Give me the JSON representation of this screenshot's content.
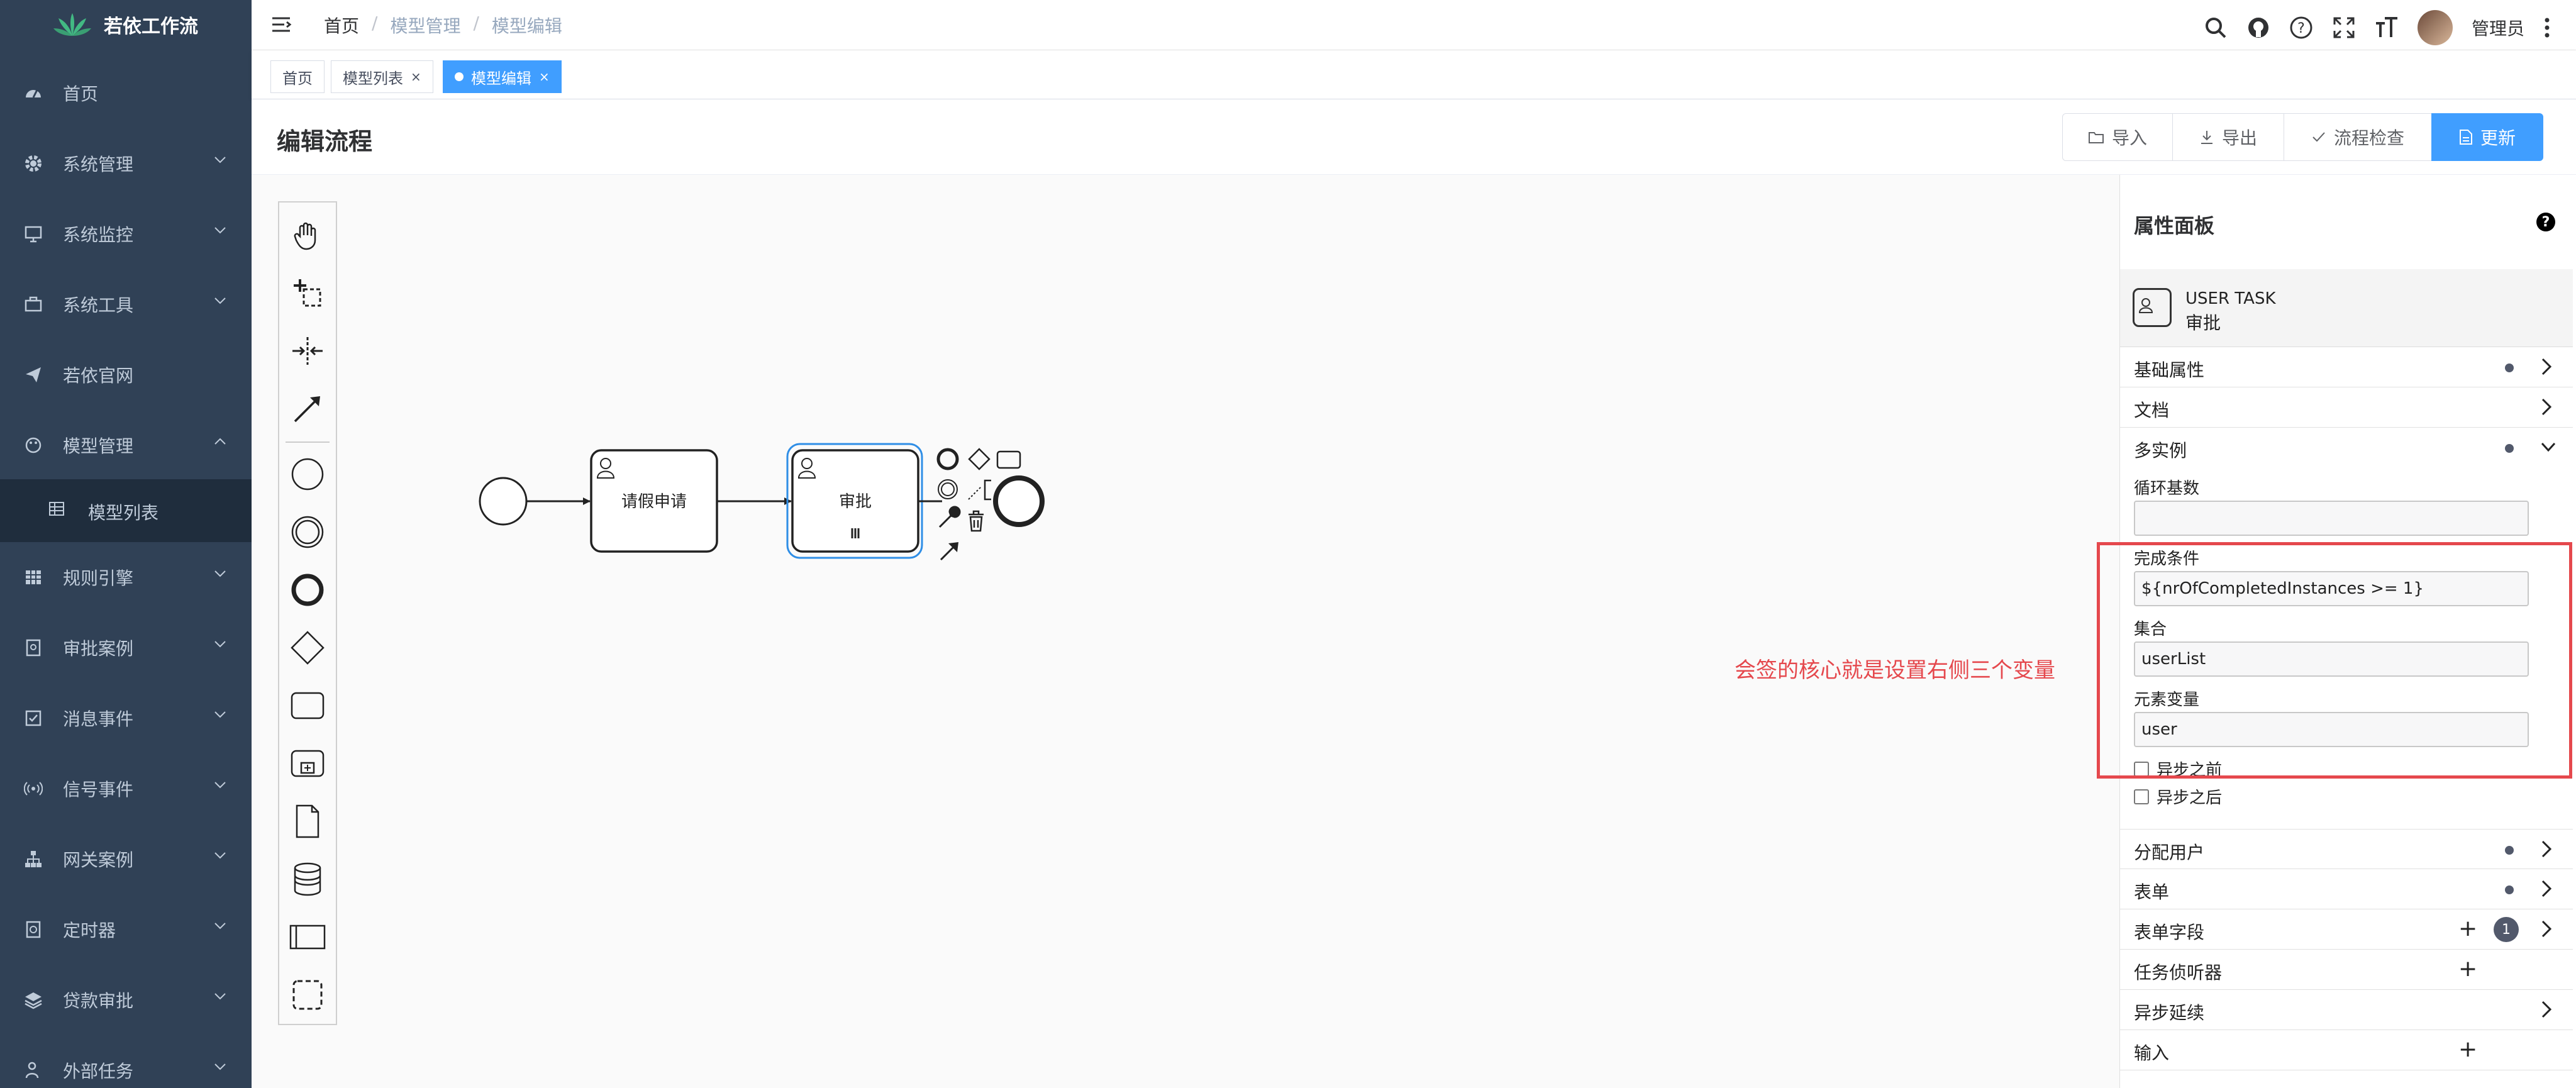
{
  "app": {
    "title": "若依工作流"
  },
  "sidebar": {
    "items": [
      {
        "label": "首页",
        "icon": "dashboard-icon",
        "has_arrow": false
      },
      {
        "label": "系统管理",
        "icon": "gear-icon",
        "has_arrow": true
      },
      {
        "label": "系统监控",
        "icon": "monitor-icon",
        "has_arrow": true
      },
      {
        "label": "系统工具",
        "icon": "toolbox-icon",
        "has_arrow": true
      },
      {
        "label": "若依官网",
        "icon": "send-icon",
        "has_arrow": false
      },
      {
        "label": "模型管理",
        "icon": "palette-icon",
        "has_arrow": true,
        "expanded": true
      },
      {
        "label": "规则引擎",
        "icon": "table-icon",
        "has_arrow": true
      },
      {
        "label": "审批案例",
        "icon": "document-icon",
        "has_arrow": true
      },
      {
        "label": "消息事件",
        "icon": "checkbox-icon",
        "has_arrow": true
      },
      {
        "label": "信号事件",
        "icon": "signal-icon",
        "has_arrow": true
      },
      {
        "label": "网关案例",
        "icon": "tree-icon",
        "has_arrow": true
      },
      {
        "label": "定时器",
        "icon": "timer-icon",
        "has_arrow": true
      },
      {
        "label": "贷款审批",
        "icon": "layers-icon",
        "has_arrow": true
      },
      {
        "label": "外部任务",
        "icon": "person-icon",
        "has_arrow": true
      }
    ],
    "submenu": {
      "label": "模型列表",
      "icon": "grid-icon"
    }
  },
  "navbar": {
    "breadcrumb": [
      "首页",
      "模型管理",
      "模型编辑"
    ],
    "user_name": "管理员",
    "icons": [
      "search-icon",
      "github-icon",
      "question-icon",
      "fullscreen-icon",
      "font-size-icon"
    ]
  },
  "tags": [
    {
      "label": "首页",
      "active": false,
      "closable": false
    },
    {
      "label": "模型列表",
      "active": false,
      "closable": true
    },
    {
      "label": "模型编辑",
      "active": true,
      "closable": true
    }
  ],
  "page": {
    "title": "编辑流程",
    "buttons": {
      "import": "导入",
      "export": "导出",
      "check": "流程检查",
      "update": "更新"
    }
  },
  "diagram": {
    "task1": "请假申请",
    "task2": "审批"
  },
  "annotation": "会签的核心就是设置右侧三个变量",
  "colors": {
    "sidebar": "#304156",
    "primary": "#409eff",
    "annotation": "#e5484d"
  },
  "props": {
    "title": "属性面板",
    "help": "?",
    "element_type": "USER TASK",
    "element_name": "审批",
    "groups_top": [
      {
        "label": "基础属性",
        "dot": true
      },
      {
        "label": "文档",
        "dot": false
      },
      {
        "label": "多实例",
        "dot": true,
        "expanded": true
      }
    ],
    "multi_instance": {
      "loop_cardinality_label": "循环基数",
      "loop_cardinality_value": "",
      "completion_label": "完成条件",
      "completion_value": "${nrOfCompletedInstances >= 1}",
      "collection_label": "集合",
      "collection_value": "userList",
      "element_variable_label": "元素变量",
      "element_variable_value": "user",
      "async_before": "异步之前",
      "async_after": "异步之后"
    },
    "groups_bottom": [
      {
        "label": "分配用户",
        "dot": true
      },
      {
        "label": "表单",
        "dot": true
      },
      {
        "label": "表单字段",
        "plus": true,
        "badge": "1"
      },
      {
        "label": "任务侦听器",
        "plus": true
      },
      {
        "label": "异步延续",
        "chevron": true
      },
      {
        "label": "输入",
        "plus": true
      }
    ]
  }
}
